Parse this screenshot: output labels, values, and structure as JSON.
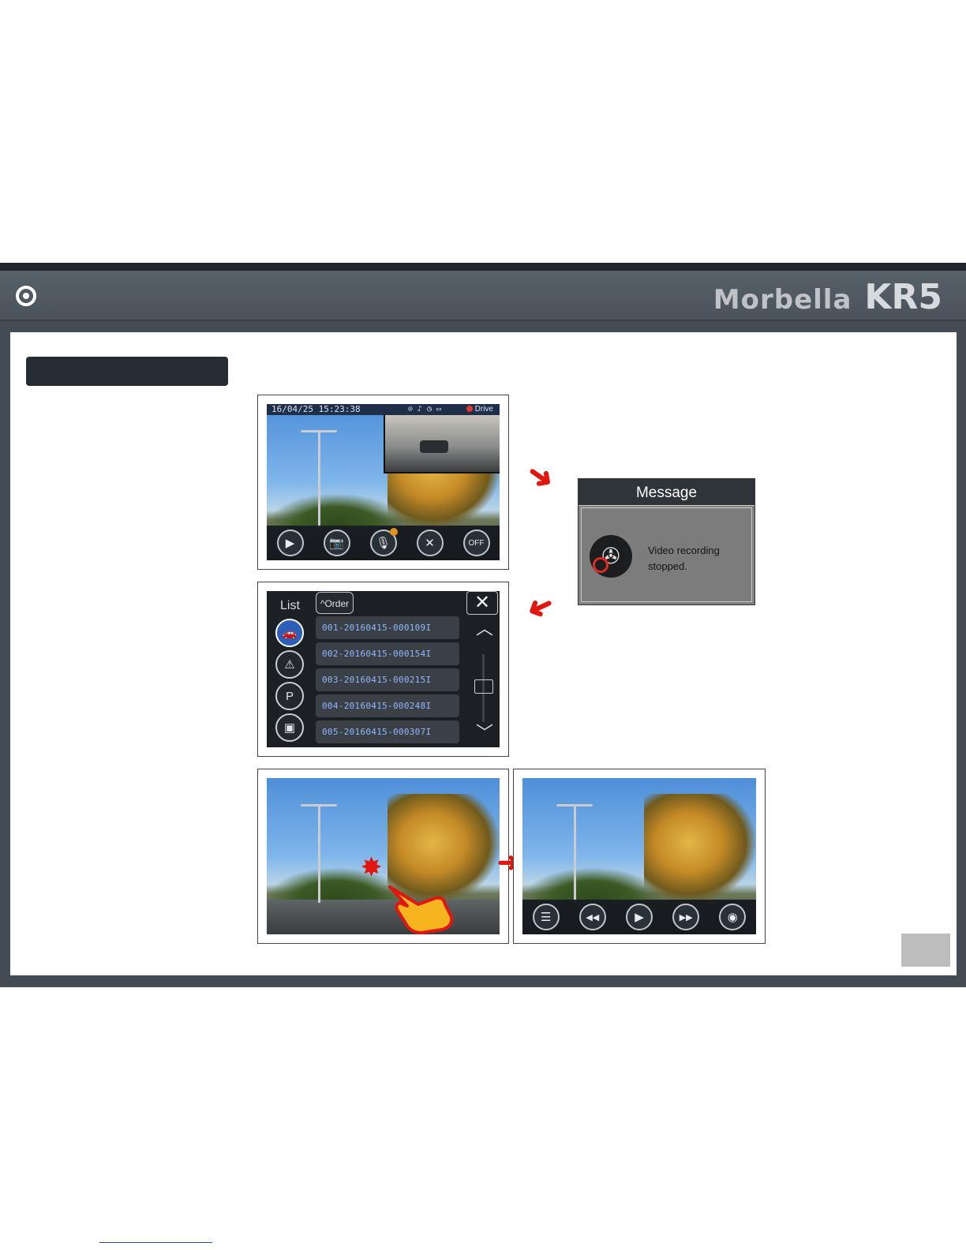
{
  "header": {
    "brand_name": "Morbella",
    "model": "KR5",
    "logo_icon": "target-icon"
  },
  "live_screen": {
    "datetime": "16/04/25 15:23:38",
    "mode": "Drive",
    "status_icons": [
      "gps-icon",
      "mic-icon",
      "timer-icon",
      "sd-card-icon",
      "record-icon"
    ],
    "buttons": [
      {
        "icon": "play-icon",
        "glyph": "▶"
      },
      {
        "icon": "camera-icon",
        "glyph": "📷"
      },
      {
        "icon": "mic-icon",
        "glyph": "🎙"
      },
      {
        "icon": "tools-icon",
        "glyph": "✕"
      },
      {
        "icon": "screen-off-icon",
        "glyph": "OFF"
      }
    ]
  },
  "message": {
    "title": "Message",
    "line1": "Video recording",
    "line2": "stopped.",
    "icon": "film-reel-icon"
  },
  "list_screen": {
    "title": "List",
    "order_label": "Order",
    "close_icon": "close-icon",
    "categories": [
      "drive-icon",
      "event-icon",
      "parking-icon",
      "photo-icon"
    ],
    "files": [
      "001-20160415-000109I",
      "002-20160415-000154I",
      "003-20160415-000215I",
      "004-20160415-000248I",
      "005-20160415-000307I"
    ]
  },
  "playback": {
    "controls": [
      {
        "icon": "list-icon",
        "glyph": "☰"
      },
      {
        "icon": "rewind-icon",
        "glyph": "◀◀"
      },
      {
        "icon": "play-icon",
        "glyph": "▶"
      },
      {
        "icon": "fast-forward-icon",
        "glyph": "▶▶"
      },
      {
        "icon": "front-camera-icon",
        "glyph": "◉"
      }
    ]
  },
  "colors": {
    "frame": "#434c54",
    "accent_red": "#e0170f",
    "list_text": "#8fb7ff"
  }
}
